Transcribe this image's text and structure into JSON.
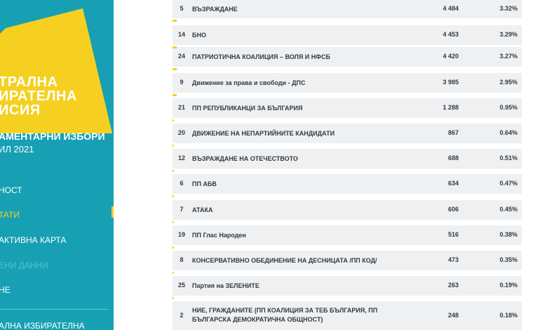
{
  "sidebar": {
    "logo_lines": [
      "ТРАЛНА",
      "ИРАТЕЛНА",
      "ИСИЯ"
    ],
    "election_title": "АМЕНТАРНИ ИЗБОРИ",
    "election_sub": "ИЛ 2021",
    "nav": [
      {
        "label": "НОСТ",
        "state": "normal"
      },
      {
        "label": "ТАТИ",
        "state": "active"
      },
      {
        "label": "АКТИВНА КАРТА",
        "state": "normal"
      },
      {
        "label": "ЕНИ ДАННИ",
        "state": "muted"
      },
      {
        "label": "НЕ",
        "state": "normal"
      }
    ],
    "footer_label": "АЛНА ИЗБИРАТЕЛНА"
  },
  "results": {
    "rows": [
      {
        "num": "5",
        "name": "ВЪЗРАЖДАНЕ",
        "votes": "4 484",
        "pct": "3.32%",
        "bar": 0.03
      },
      {
        "num": "14",
        "name": "БНО",
        "votes": "4 453",
        "pct": "3.29%",
        "bar": 0.03
      },
      {
        "num": "24",
        "name": "ПАТРИОТИЧНА КОАЛИЦИЯ – ВОЛЯ И НФСБ",
        "votes": "4 420",
        "pct": "3.27%",
        "bar": 0.03
      },
      {
        "num": "9",
        "name": "Движение за права и свободи - ДПС",
        "votes": "3 985",
        "pct": "2.95%",
        "bar": 0.03
      },
      {
        "num": "21",
        "name": "ПП РЕПУБЛИКАНЦИ ЗА БЪЛГАРИЯ",
        "votes": "1 288",
        "pct": "0.95%",
        "bar": 0.01
      },
      {
        "num": "20",
        "name": "ДВИЖЕНИЕ НА НЕПАРТИЙНИТЕ КАНДИДАТИ",
        "votes": "867",
        "pct": "0.64%",
        "bar": 0.006
      },
      {
        "num": "12",
        "name": "ВЪЗРАЖДАНЕ НА ОТЕЧЕСТВОТО",
        "votes": "688",
        "pct": "0.51%",
        "bar": 0.005
      },
      {
        "num": "6",
        "name": "ПП АБВ",
        "votes": "634",
        "pct": "0.47%",
        "bar": 0.005
      },
      {
        "num": "7",
        "name": "АТАКА",
        "votes": "606",
        "pct": "0.45%",
        "bar": 0.004
      },
      {
        "num": "19",
        "name": "ПП Глас Народен",
        "votes": "516",
        "pct": "0.38%",
        "bar": 0.004
      },
      {
        "num": "8",
        "name": "КОНСЕРВАТИВНО ОБЕДИНЕНИЕ НА ДЕСНИЦАТА /ПП КОД/",
        "votes": "473",
        "pct": "0.35%",
        "bar": 0.003
      },
      {
        "num": "25",
        "name": "Партия на ЗЕЛЕНИТЕ",
        "votes": "263",
        "pct": "0.19%",
        "bar": 0.002
      },
      {
        "num": "2",
        "name": "НИЕ, ГРАЖДАНИТЕ (ПП КОАЛИЦИЯ ЗА ТЕБ БЪЛГАРИЯ, ПП БЪЛГАРСКА ДЕМОКРАТИЧНА ОБЩНОСТ)",
        "votes": "248",
        "pct": "0.18%",
        "bar": 0.002
      }
    ]
  },
  "colors": {
    "sidebar_bg": "#17a0b4",
    "accent_yellow": "#f5d020",
    "row_bg": "#eef0f2",
    "text_dark": "#333a40"
  }
}
